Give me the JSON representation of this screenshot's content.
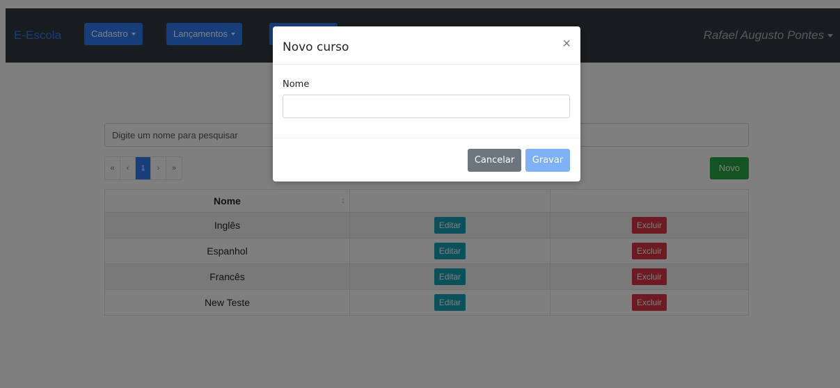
{
  "navbar": {
    "brand": "E-Escola",
    "menus": [
      {
        "label": "Cadastro"
      },
      {
        "label": "Lançamentos"
      },
      {
        "label": ""
      }
    ],
    "user": "Rafael Augusto Pontes"
  },
  "search": {
    "placeholder": "Digite um nome para pesquisar"
  },
  "pagination": {
    "first": "«",
    "prev": "‹",
    "current": "1",
    "next": "›",
    "last": "»"
  },
  "actions": {
    "new_label": "Novo"
  },
  "table": {
    "headers": [
      "Nome",
      "",
      ""
    ],
    "rows": [
      {
        "name": "Inglês",
        "edit": "Editar",
        "delete": "Excluir"
      },
      {
        "name": "Espanhol",
        "edit": "Editar",
        "delete": "Excluir"
      },
      {
        "name": "Francês",
        "edit": "Editar",
        "delete": "Excluir"
      },
      {
        "name": "New Teste",
        "edit": "Editar",
        "delete": "Excluir"
      }
    ]
  },
  "modal": {
    "title": "Novo curso",
    "close": "×",
    "field_label": "Nome",
    "field_value": "",
    "cancel_label": "Cancelar",
    "save_label": "Gravar"
  },
  "colors": {
    "primary": "#2f7cf6",
    "success": "#28a745",
    "info": "#17a2b8",
    "danger": "#dc3545",
    "secondary": "#6c757d",
    "navbar": "#343a40"
  }
}
